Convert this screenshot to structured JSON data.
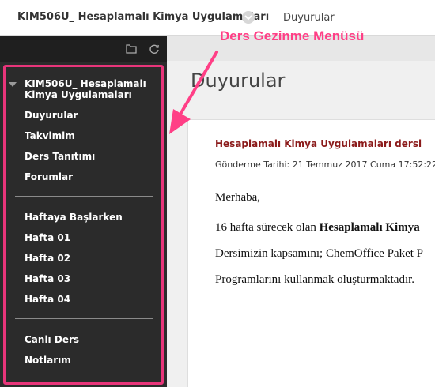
{
  "topbar": {
    "course_title": "KIM506U_ Hesaplamalı Kimya Uygulamaları",
    "breadcrumb": "Duyurular"
  },
  "sidebar": {
    "course_name": "KIM506U_ Hesaplamalı Kimya Uygulamaları",
    "groups": [
      [
        "Duyurular",
        "Takvimim",
        "Ders Tanıtımı",
        "Forumlar"
      ],
      [
        "Haftaya Başlarken",
        "Hafta 01",
        "Hafta 02",
        "Hafta 03",
        "Hafta 04"
      ],
      [
        "Canlı Ders",
        "Notlarım"
      ]
    ]
  },
  "main": {
    "title": "Duyurular",
    "announcement": {
      "title": "Hesaplamalı Kimya Uygulamaları dersi",
      "date": "Gönderme Tarihi: 21 Temmuz 2017 Cuma 17:52:22",
      "greeting": "Merhaba,",
      "line1_prefix": "16 hafta sürecek olan ",
      "line1_bold": "Hesaplamalı Kimya",
      "line2": "Dersimizin kapsamını; ChemOffice Paket P",
      "line3": "Programlarını kullanmak oluşturmaktadır."
    }
  },
  "annotation": {
    "label": "Ders Gezinme Menüsü",
    "color": "#ff3f86"
  },
  "colors": {
    "sidebar_bg": "#2b2b2b",
    "highlight_frame": "#e8357a",
    "announcement_title": "#8b1a1a"
  }
}
